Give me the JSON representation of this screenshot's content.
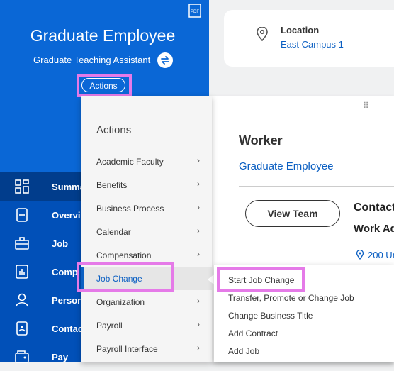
{
  "header": {
    "name": "Graduate Employee",
    "role": "Graduate Teaching Assistant",
    "actions_label": "Actions",
    "pdf_icon": "pdf-icon",
    "swap_icon": "swap-icon"
  },
  "nav": {
    "items": [
      {
        "label": "Summa",
        "icon": "grid-icon"
      },
      {
        "label": "Overvie",
        "icon": "document-icon"
      },
      {
        "label": "Job",
        "icon": "briefcase-icon"
      },
      {
        "label": "Comp",
        "icon": "bar-chart-icon"
      },
      {
        "label": "Person",
        "icon": "person-icon"
      },
      {
        "label": "Contac",
        "icon": "contact-card-icon"
      },
      {
        "label": "Pay",
        "icon": "wallet-icon"
      }
    ]
  },
  "location": {
    "label": "Location",
    "value": "East Campus 1"
  },
  "actions_menu": {
    "title": "Actions",
    "items": [
      {
        "label": "Academic Faculty"
      },
      {
        "label": "Benefits"
      },
      {
        "label": "Business Process"
      },
      {
        "label": "Calendar"
      },
      {
        "label": "Compensation"
      },
      {
        "label": "Job Change"
      },
      {
        "label": "Organization"
      },
      {
        "label": "Payroll"
      },
      {
        "label": "Payroll Interface"
      }
    ]
  },
  "worker": {
    "title": "Worker",
    "name_link": "Graduate Employee",
    "view_team": "View Team",
    "contact_heading": "Contact",
    "work_address_heading": "Work Ad",
    "address_value": "200 Ur"
  },
  "job_change_submenu": {
    "items": [
      {
        "label": "Start Job Change"
      },
      {
        "label": "Transfer, Promote or Change Job"
      },
      {
        "label": "Change Business Title"
      },
      {
        "label": "Add Contract"
      },
      {
        "label": "Add Job"
      }
    ]
  },
  "colors": {
    "header_blue": "#0a67d6",
    "nav_blue": "#0150b8",
    "link_blue": "#0b5fc2",
    "highlight": "#e57ae8"
  }
}
